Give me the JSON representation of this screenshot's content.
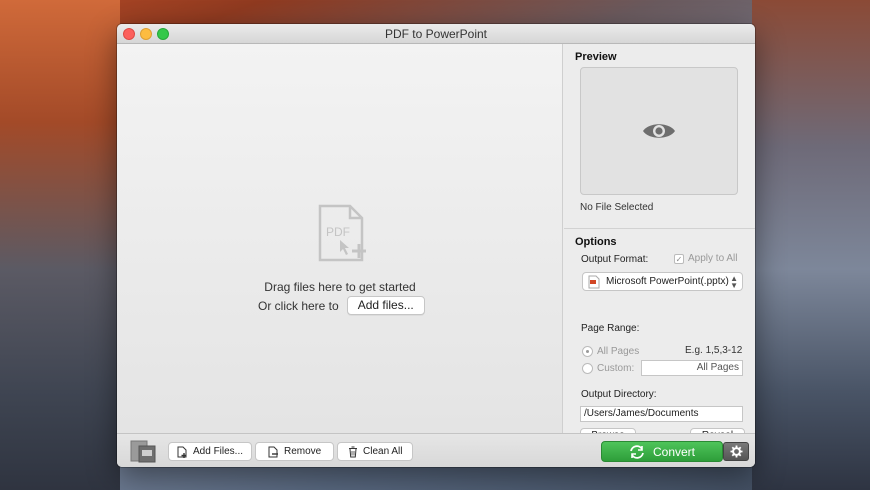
{
  "window": {
    "title": "PDF to PowerPoint"
  },
  "dropzone": {
    "icon_text": "PDF",
    "drag_text": "Drag files here to get started",
    "click_text": "Or click here to",
    "add_files_label": "Add files..."
  },
  "preview": {
    "title": "Preview",
    "status": "No File Selected"
  },
  "options": {
    "title": "Options",
    "output_format_label": "Output Format:",
    "apply_to_all_label": "Apply to All",
    "format_value": "Microsoft PowerPoint(.pptx)",
    "page_range_label": "Page Range:",
    "all_pages_label": "All Pages",
    "example_text": "E.g. 1,5,3-12",
    "custom_label": "Custom:",
    "custom_value": "All Pages",
    "output_dir_label": "Output Directory:",
    "output_dir_value": "/Users/James/Documents",
    "browse_label": "Browse",
    "reveal_label": "Reveal"
  },
  "toolbar": {
    "add_files_label": "Add Files...",
    "remove_label": "Remove",
    "clean_all_label": "Clean All",
    "convert_label": "Convert"
  },
  "colors": {
    "convert_green": "#3db24a",
    "window_bg": "#ececec"
  }
}
